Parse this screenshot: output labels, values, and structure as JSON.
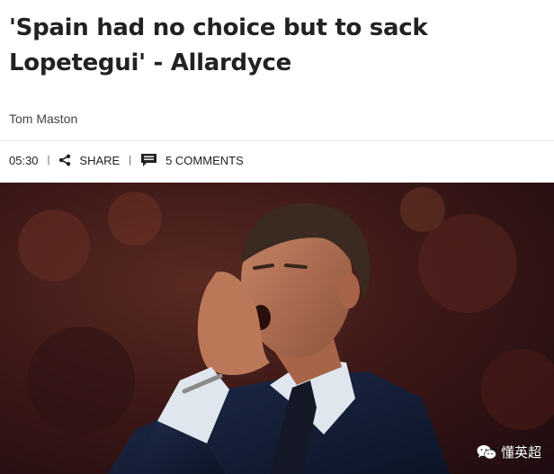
{
  "article": {
    "headline": "'Spain had no choice but to sack Lopetegui' - Allardyce",
    "author": "Tom Maston"
  },
  "meta": {
    "time": "05:30",
    "separator": "|",
    "share_label": "SHARE",
    "comments_label": "5 COMMENTS",
    "share_icon": "share-icon",
    "comments_icon": "comment-icon"
  },
  "photo": {
    "icon": "photo-manager-shouting",
    "watermark_text": "懂英超",
    "watermark_icon": "wechat-icon"
  },
  "colors": {
    "headline": "#222222",
    "author": "#444444",
    "divider": "#e6e6e6"
  }
}
